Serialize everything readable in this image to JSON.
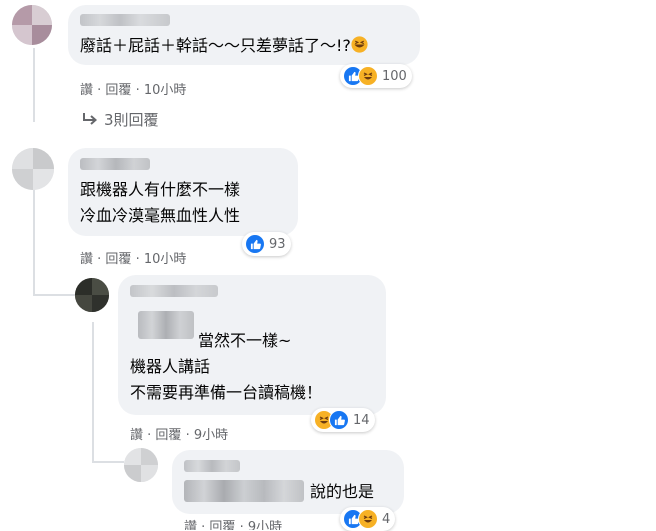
{
  "comments": [
    {
      "text_lines": [
        "廢話＋屁話＋幹話～～只差夢話了～!?"
      ],
      "meta": {
        "action1": "讚",
        "action2": "回覆",
        "time": "10小時"
      },
      "reaction_count": "100",
      "reaction_icons": [
        "like-icon",
        "haha-icon"
      ],
      "replies_link": "3則回覆"
    },
    {
      "text_lines": [
        "跟機器人有什麼不一樣",
        "冷血冷漠毫無血性人性"
      ],
      "meta": {
        "action1": "讚",
        "action2": "回覆",
        "time": "10小時"
      },
      "reaction_count": "93",
      "reaction_icons": [
        "like-icon"
      ]
    },
    {
      "text_lines": [
        "當然不一樣~",
        "機器人講話",
        "不需要再準備一台讀稿機！"
      ],
      "meta": {
        "action1": "讚",
        "action2": "回覆",
        "time": "9小時"
      },
      "reaction_count": "14",
      "reaction_icons": [
        "haha-icon",
        "like-icon"
      ]
    },
    {
      "text_lines": [
        "說的也是"
      ],
      "meta": {
        "action1": "讚",
        "action2": "回覆",
        "time": "9小時"
      },
      "reaction_count": "4",
      "reaction_icons": [
        "like-icon",
        "haha-icon"
      ]
    }
  ],
  "colors": {
    "like": "#1877f2",
    "haha": "#f7b125",
    "bubble": "#f0f2f5",
    "meta": "#65676b"
  }
}
